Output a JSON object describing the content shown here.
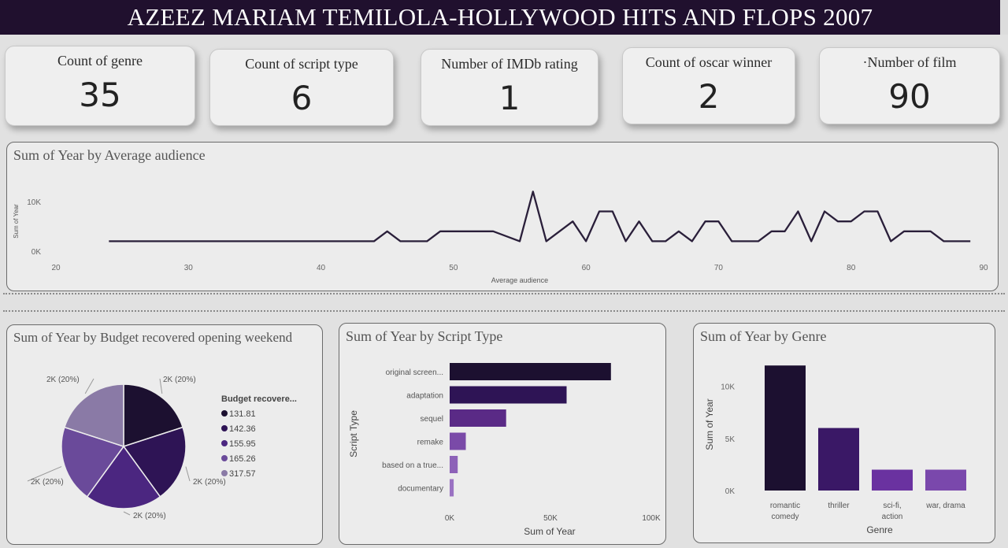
{
  "header": {
    "title": "AZEEZ MARIAM TEMILOLA-HOLLYWOOD HITS AND FLOPS 2007"
  },
  "cards": [
    {
      "label": "Count of genre",
      "value": "35"
    },
    {
      "label": "Count of script type",
      "value": "6"
    },
    {
      "label": "Number of IMDb rating",
      "value": "1"
    },
    {
      "label": "Count of oscar winner",
      "value": "2"
    },
    {
      "label": "·Number of film",
      "value": "90"
    }
  ],
  "line_chart": {
    "title": "Sum of Year by Average audience",
    "y_tick_labels": [
      "10K",
      "0K"
    ],
    "x_tick_labels": [
      "20",
      "30",
      "40",
      "50",
      "60",
      "70",
      "80",
      "90"
    ]
  },
  "pie_chart": {
    "title": "Sum of Year by Budget recovered opening weekend",
    "legend_title": "Budget recovere...",
    "slice_labels": [
      "2K (20%)",
      "2K (20%)",
      "2K (20%)",
      "2K (20%)",
      "2K (20%)"
    ]
  },
  "script_chart": {
    "title": "Sum of Year by Script Type",
    "x_tick_labels": [
      "0K",
      "50K",
      "100K"
    ]
  },
  "genre_chart": {
    "title": "Sum of Year by Genre",
    "y_tick_labels": [
      "10K",
      "5K",
      "0K"
    ]
  },
  "chart_data": [
    {
      "type": "line",
      "title": "Sum of Year by Average audience",
      "xlabel": "Average audience",
      "ylabel": "Sum of Year",
      "xlim": [
        20,
        90
      ],
      "ylim": [
        0,
        13000
      ],
      "grid": false,
      "x": [
        24,
        44,
        45,
        46,
        48,
        49,
        50,
        53,
        55,
        56,
        57,
        58,
        59,
        60,
        61,
        62,
        63,
        64,
        65,
        66,
        67,
        68,
        69,
        70,
        71,
        72,
        73,
        74,
        75,
        76,
        77,
        78,
        79,
        80,
        81,
        82,
        83,
        84,
        86,
        87,
        88,
        89
      ],
      "y": [
        2000,
        2000,
        4000,
        2000,
        2000,
        4000,
        4000,
        4000,
        2000,
        12000,
        2000,
        4000,
        6000,
        2000,
        8000,
        8000,
        2000,
        6000,
        2000,
        2000,
        4000,
        2000,
        6000,
        6000,
        2000,
        2000,
        2000,
        4000,
        4000,
        8000,
        2000,
        8000,
        6000,
        6000,
        8000,
        8000,
        2000,
        4000,
        4000,
        2000,
        2000,
        2000
      ]
    },
    {
      "type": "pie",
      "title": "Sum of Year by Budget recovered opening weekend",
      "legend_title": "Budget recovere...",
      "legend_position": "right",
      "categories": [
        "131.81",
        "142.36",
        "155.95",
        "165.26",
        "317.57"
      ],
      "values": [
        2007,
        2007,
        2007,
        2007,
        2007
      ],
      "colors": [
        "#1c1030",
        "#2e1455",
        "#4b2680",
        "#6a4a9a",
        "#8a7aa6"
      ]
    },
    {
      "type": "bar",
      "orientation": "horizontal",
      "title": "Sum of Year by Script Type",
      "xlabel": "Sum of Year",
      "ylabel": "Script Type",
      "xlim": [
        0,
        100000
      ],
      "categories": [
        "original screen...",
        "adaptation",
        "sequel",
        "remake",
        "based on a true...",
        "documentary"
      ],
      "values": [
        80000,
        58000,
        28000,
        8000,
        4000,
        2000
      ],
      "colors": [
        "#1c1030",
        "#2e1455",
        "#5a2a86",
        "#7a4aa8",
        "#8d62b8",
        "#9a72c2"
      ]
    },
    {
      "type": "bar",
      "title": "Sum of Year by Genre",
      "xlabel": "Genre",
      "ylabel": "Sum of Year",
      "ylim": [
        0,
        13000
      ],
      "categories": [
        "romantic comedy",
        "thriller",
        "sci-fi, action",
        "war, drama"
      ],
      "values": [
        12000,
        6000,
        2000,
        2000
      ],
      "colors": [
        "#1c1030",
        "#3a1866",
        "#6a32a0",
        "#7a48ac"
      ]
    }
  ]
}
